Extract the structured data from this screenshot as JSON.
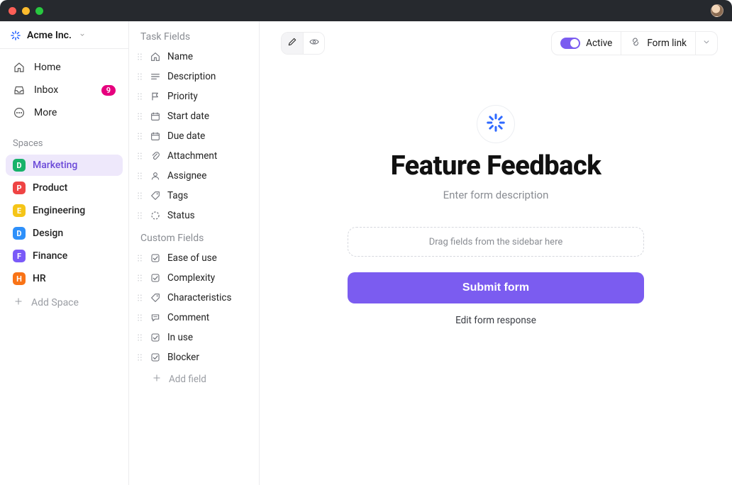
{
  "workspace": {
    "name": "Acme Inc."
  },
  "nav": {
    "home": "Home",
    "inbox": "Inbox",
    "inbox_badge": "9",
    "more": "More"
  },
  "spaces_header": "Spaces",
  "spaces": [
    {
      "letter": "D",
      "label": "Marketing",
      "color": "#17b26a",
      "active": true
    },
    {
      "letter": "P",
      "label": "Product",
      "color": "#ef4444",
      "active": false
    },
    {
      "letter": "E",
      "label": "Engineering",
      "color": "#f5c518",
      "active": false
    },
    {
      "letter": "D",
      "label": "Design",
      "color": "#2e90fa",
      "active": false
    },
    {
      "letter": "F",
      "label": "Finance",
      "color": "#7a5af8",
      "active": false
    },
    {
      "letter": "H",
      "label": "HR",
      "color": "#f97316",
      "active": false
    }
  ],
  "add_space": "Add Space",
  "task_fields_header": "Task Fields",
  "task_fields": [
    {
      "icon": "home",
      "label": "Name"
    },
    {
      "icon": "lines",
      "label": "Description"
    },
    {
      "icon": "flag",
      "label": "Priority"
    },
    {
      "icon": "calendar",
      "label": "Start date"
    },
    {
      "icon": "calendar",
      "label": "Due date"
    },
    {
      "icon": "clip",
      "label": "Attachment"
    },
    {
      "icon": "user",
      "label": "Assignee"
    },
    {
      "icon": "tag",
      "label": "Tags"
    },
    {
      "icon": "dashed-circle",
      "label": "Status"
    }
  ],
  "custom_fields_header": "Custom Fields",
  "custom_fields": [
    {
      "icon": "checkbox",
      "label": "Ease of use"
    },
    {
      "icon": "checkbox",
      "label": "Complexity"
    },
    {
      "icon": "tag",
      "label": "Characteristics"
    },
    {
      "icon": "comment",
      "label": "Comment"
    },
    {
      "icon": "checkbox",
      "label": "In use"
    },
    {
      "icon": "checkbox",
      "label": "Blocker"
    }
  ],
  "add_field": "Add field",
  "toolbar": {
    "active_label": "Active",
    "form_link_label": "Form link"
  },
  "form": {
    "title": "Feature Feedback",
    "description_placeholder": "Enter form description",
    "dropzone": "Drag fields from the sidebar here",
    "submit": "Submit form",
    "edit_response": "Edit form response"
  },
  "colors": {
    "accent": "#7b5cf0",
    "badge": "#e6007e"
  }
}
